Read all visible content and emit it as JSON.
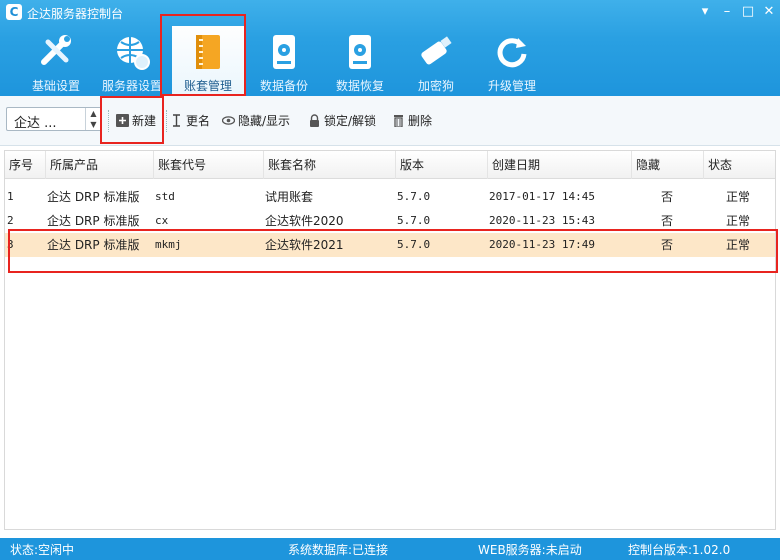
{
  "window": {
    "title": "企达服务器控制台"
  },
  "ribbon": {
    "items": [
      {
        "label": "基础设置",
        "icon": "wrench-screwdriver-icon"
      },
      {
        "label": "服务器设置",
        "icon": "globe-gear-icon"
      },
      {
        "label": "账套管理",
        "icon": "notebook-icon",
        "active": true
      },
      {
        "label": "数据备份",
        "icon": "disk-backup-icon"
      },
      {
        "label": "数据恢复",
        "icon": "disk-restore-icon"
      },
      {
        "label": "加密狗",
        "icon": "usb-dongle-icon"
      },
      {
        "label": "升级管理",
        "icon": "refresh-icon"
      }
    ]
  },
  "toolbar": {
    "product_select": "企达 ...",
    "new_label": "新建",
    "rename_label": "更名",
    "toggle_label": "隐藏/显示",
    "lock_label": "锁定/解锁",
    "delete_label": "删除"
  },
  "table": {
    "columns": [
      "序号",
      "所属产品",
      "账套代号",
      "账套名称",
      "版本",
      "创建日期",
      "隐藏",
      "状态"
    ],
    "rows": [
      [
        "1",
        "企达 DRP 标准版",
        "std",
        "试用账套",
        "5.7.0",
        "2017-01-17 14:45",
        "否",
        "正常"
      ],
      [
        "2",
        "企达 DRP 标准版",
        "cx",
        "企达软件2020",
        "5.7.0",
        "2020-11-23 15:43",
        "否",
        "正常"
      ],
      [
        "3",
        "企达 DRP 标准版",
        "mkmj",
        "企达软件2021",
        "5.7.0",
        "2020-11-23 17:49",
        "否",
        "正常"
      ]
    ],
    "selected_row": 3
  },
  "status": {
    "state": "状态:空闲中",
    "db": "系统数据库:已连接",
    "web": "WEB服务器:未启动",
    "version": "控制台版本:1.02.0"
  },
  "colors": {
    "accent": "#1e95dc",
    "selected_row": "#fde7c8",
    "annotation": "#e8241f"
  }
}
